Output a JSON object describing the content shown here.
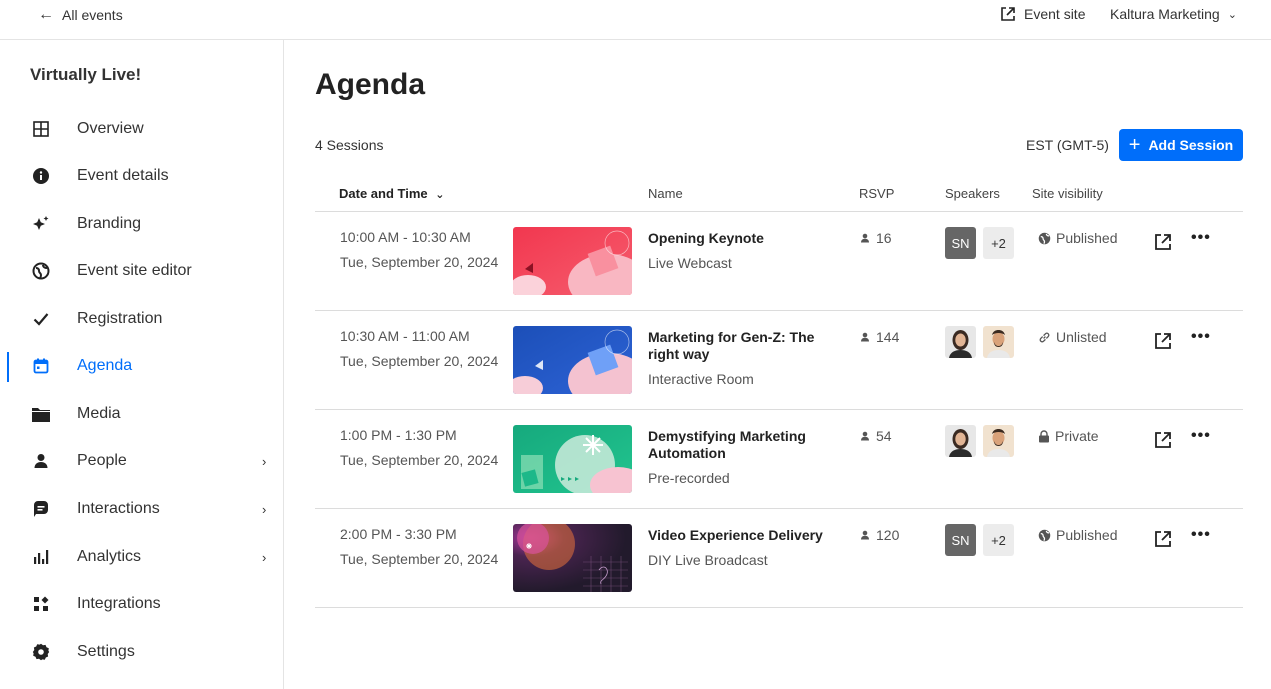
{
  "topbar": {
    "back_label": "All events",
    "event_site_label": "Event site",
    "org_label": "Kaltura Marketing"
  },
  "sidebar": {
    "title": "Virtually Live!",
    "items": [
      {
        "label": "Overview",
        "icon": "grid-icon"
      },
      {
        "label": "Event details",
        "icon": "info-icon"
      },
      {
        "label": "Branding",
        "icon": "sparkle-icon"
      },
      {
        "label": "Event site editor",
        "icon": "globe-icon"
      },
      {
        "label": "Registration",
        "icon": "check-icon"
      },
      {
        "label": "Agenda",
        "icon": "calendar-icon",
        "active": true
      },
      {
        "label": "Media",
        "icon": "folder-icon"
      },
      {
        "label": "People",
        "icon": "person-icon",
        "has_submenu": true
      },
      {
        "label": "Interactions",
        "icon": "chat-icon",
        "has_submenu": true
      },
      {
        "label": "Analytics",
        "icon": "bar-chart-icon",
        "has_submenu": true
      },
      {
        "label": "Integrations",
        "icon": "integrations-icon"
      },
      {
        "label": "Settings",
        "icon": "gear-icon"
      }
    ]
  },
  "main": {
    "title": "Agenda",
    "sessions_count": "4 Sessions",
    "timezone": "EST (GMT-5)",
    "add_button": "Add Session",
    "columns": {
      "date": "Date and Time",
      "name": "Name",
      "rsvp": "RSVP",
      "speakers": "Speakers",
      "visibility": "Site visibility"
    },
    "rows": [
      {
        "time": "10:00 AM - 10:30 AM",
        "date": "Tue, September 20, 2024",
        "title": "Opening Keynote",
        "type": "Live Webcast",
        "rsvp": "16",
        "speaker_initials": "SN",
        "speaker_more": "+2",
        "visibility": "Published",
        "visibility_icon": "globe-icon"
      },
      {
        "time": "10:30 AM - 11:00 AM",
        "date": "Tue, September 20, 2024",
        "title": "Marketing for Gen-Z: The right way",
        "type": "Interactive Room",
        "rsvp": "144",
        "visibility": "Unlisted",
        "visibility_icon": "link-icon"
      },
      {
        "time": "1:00 PM - 1:30 PM",
        "date": "Tue, September 20, 2024",
        "title": "Demystifying Marketing Automation",
        "type": "Pre-recorded",
        "rsvp": "54",
        "visibility": "Private",
        "visibility_icon": "lock-icon"
      },
      {
        "time": "2:00 PM - 3:30 PM",
        "date": "Tue, September 20, 2024",
        "title": "Video Experience Delivery",
        "type": "DIY Live Broadcast",
        "rsvp": "120",
        "speaker_initials": "SN",
        "speaker_more": "+2",
        "visibility": "Published",
        "visibility_icon": "globe-icon"
      }
    ]
  },
  "colors": {
    "accent": "#006EFA",
    "thumb_red": "#F2374F",
    "thumb_blue": "#1C4FB8",
    "thumb_green": "#1DB889",
    "thumb_dark": "#2A1E3A"
  }
}
